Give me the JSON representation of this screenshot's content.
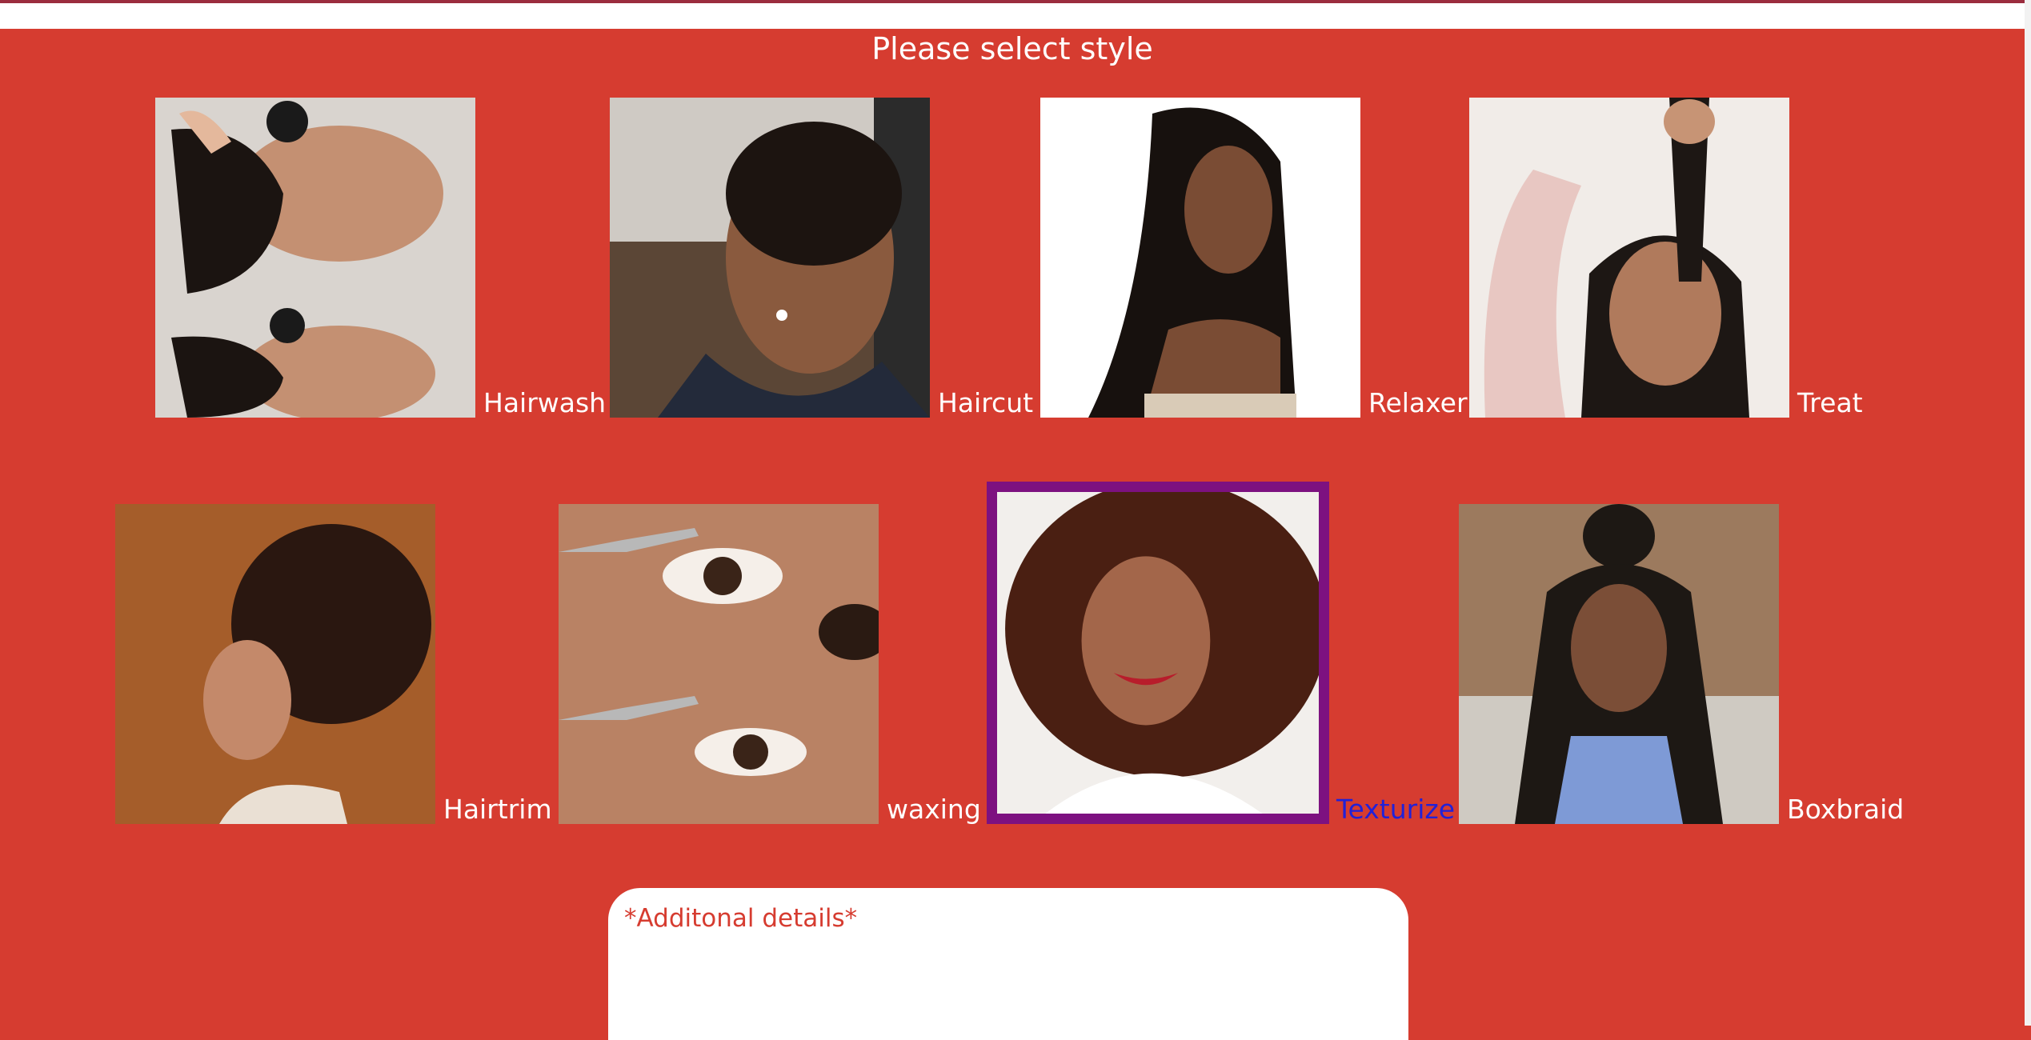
{
  "header": {
    "title": "Please select style"
  },
  "styles": [
    {
      "label": "Hairwash"
    },
    {
      "label": "Haircut"
    },
    {
      "label": "Relaxer"
    },
    {
      "label": "Treat"
    },
    {
      "label": "Hairtrim"
    },
    {
      "label": "waxing"
    },
    {
      "label": "Texturize",
      "selected": true
    },
    {
      "label": "Boxbraid"
    }
  ],
  "details": {
    "placeholder": "*Additonal details*"
  },
  "colors": {
    "background": "#d63c30",
    "selected_border": "#7d1180",
    "selected_label": "#2121d8",
    "label": "#ffffff"
  }
}
